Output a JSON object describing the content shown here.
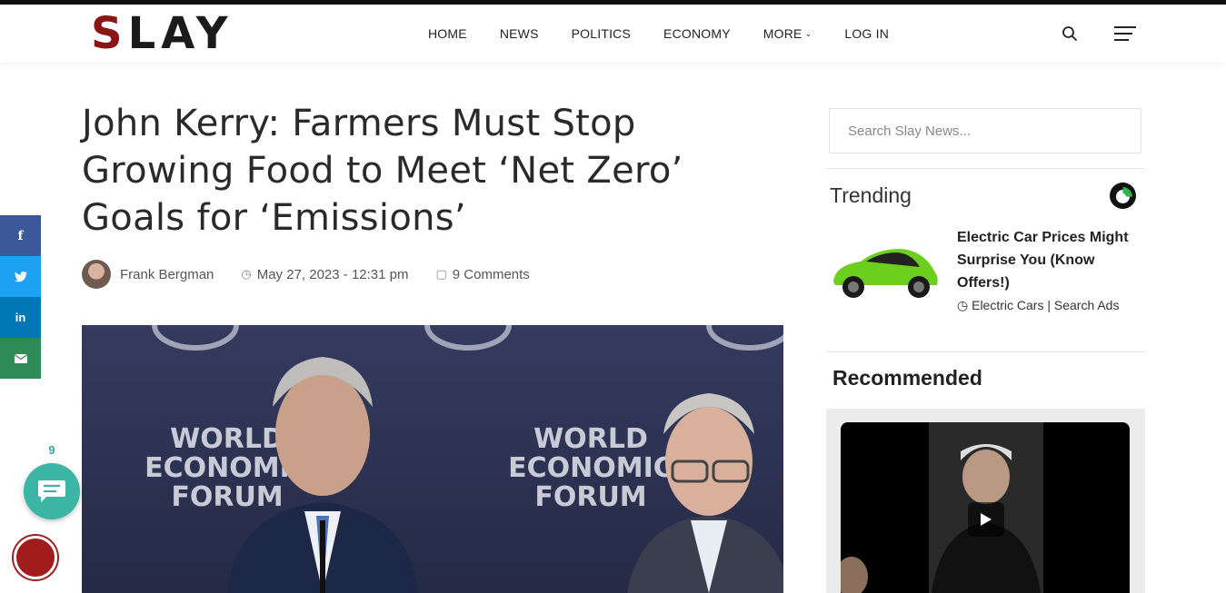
{
  "site": {
    "logo_first": "S",
    "logo_rest": "LAY",
    "brand_color": "#8b1414"
  },
  "nav": {
    "items": [
      "HOME",
      "NEWS",
      "POLITICS",
      "ECONOMY",
      "MORE",
      "LOG IN"
    ]
  },
  "article": {
    "title": "John Kerry: Farmers Must Stop Growing Food to Meet ‘Net Zero’ Goals for ‘Emissions’",
    "author": "Frank Bergman",
    "date": "May 27, 2023 - 12:31 pm",
    "comments": "9 Comments",
    "image_backdrop_text": [
      "WORLD",
      "ECONOMIC",
      "FORUM"
    ]
  },
  "share": {
    "colors": {
      "facebook": "#3b5998",
      "twitter": "#1da1f2",
      "linkedin": "#0077b5",
      "email": "#2e8b57"
    }
  },
  "comment_widget": {
    "count": "9"
  },
  "sidebar": {
    "search_placeholder": "Search Slay News...",
    "trending_label": "Trending",
    "trending_item": {
      "title_lines": [
        "Electric Car Prices Might",
        "Surprise You (Know",
        "Offers!)"
      ],
      "source": "Electric Cars | Search Ads"
    },
    "recommended_label": "Recommended"
  }
}
